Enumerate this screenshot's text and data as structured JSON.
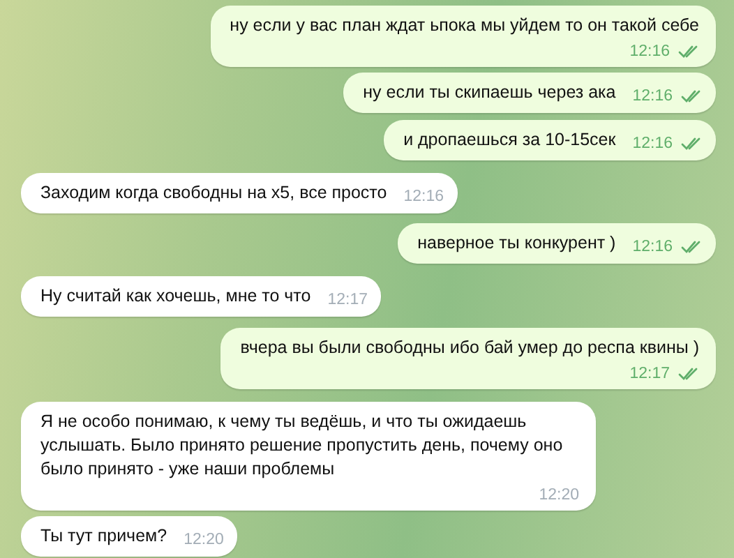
{
  "messages": [
    {
      "text": "ну если у вас план ждат ьпока мы уйдем то он такой себе",
      "time": "12:16",
      "outgoing": true,
      "read": true,
      "kind": "stacked"
    },
    {
      "text": "ну если ты скипаешь через ака",
      "time": "12:16",
      "outgoing": true,
      "read": true,
      "kind": "inline"
    },
    {
      "text": "и дропаешься за 10-15сек",
      "time": "12:16",
      "outgoing": true,
      "read": true,
      "kind": "inline"
    },
    {
      "text": "Заходим когда свободны на x5, все просто",
      "time": "12:16",
      "outgoing": false,
      "kind": "inline"
    },
    {
      "text": "наверное ты конкурент )",
      "time": "12:16",
      "outgoing": true,
      "read": true,
      "kind": "inline"
    },
    {
      "text": "Ну считай как хочешь, мне то что",
      "time": "12:17",
      "outgoing": false,
      "kind": "inline"
    },
    {
      "text": "вчера вы были свободны ибо бай умер до респа квины )",
      "time": "12:17",
      "outgoing": true,
      "read": true,
      "kind": "stacked"
    },
    {
      "text": "Я не особо понимаю, к чему ты ведёшь, и что ты ожидаешь услышать. Было принято решение пропустить день, почему оно было принято - уже наши проблемы",
      "time": "12:20",
      "outgoing": false,
      "kind": "stacked"
    },
    {
      "text": "Ты тут причем?",
      "time": "12:20",
      "outgoing": false,
      "kind": "inline"
    }
  ]
}
